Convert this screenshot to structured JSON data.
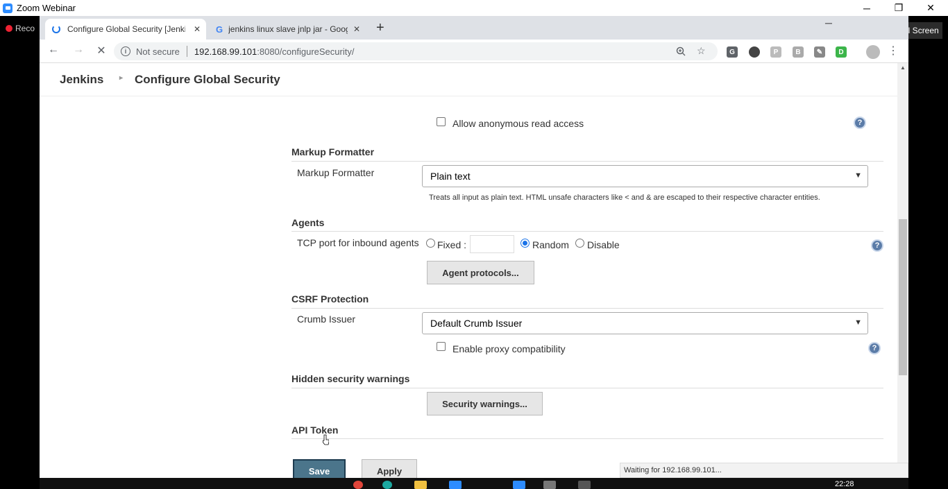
{
  "zoom": {
    "title": "Zoom Webinar",
    "recording_label": "Reco",
    "fullscreen_label": "Enter Full Screen",
    "minimize": "─",
    "restore": "❐",
    "close": "✕"
  },
  "browser": {
    "tabs": [
      {
        "title": "Configure Global Security [Jenkins]",
        "close": "✕"
      },
      {
        "title": "jenkins linux slave jnlp jar - Goog",
        "close": "✕"
      }
    ],
    "new_tab": "+",
    "not_secure": "Not secure",
    "url_host": "192.168.99.101",
    "url_rest": ":8080/configureSecurity/",
    "status_text": "Waiting for 192.168.99.101..."
  },
  "jenkins": {
    "breadcrumb_root": "Jenkins",
    "breadcrumb_page": "Configure Global Security",
    "allow_anonymous_label": "Allow anonymous read access",
    "markup_formatter": {
      "section": "Markup Formatter",
      "label": "Markup Formatter",
      "selected": "Plain text",
      "description": "Treats all input as plain text. HTML unsafe characters like < and & are escaped to their respective character entities."
    },
    "agents": {
      "section": "Agents",
      "label": "TCP port for inbound agents",
      "fixed": "Fixed :",
      "fixed_value": "",
      "random": "Random",
      "disable": "Disable",
      "protocols_button": "Agent protocols..."
    },
    "csrf": {
      "section": "CSRF Protection",
      "label": "Crumb Issuer",
      "selected": "Default Crumb Issuer",
      "proxy_label": "Enable proxy compatibility"
    },
    "hidden_warnings": {
      "section": "Hidden security warnings",
      "button": "Security warnings..."
    },
    "api_token": {
      "section": "API Token"
    },
    "save": "Save",
    "apply": "Apply",
    "help": "?"
  },
  "taskbar": {
    "time": "22:28"
  }
}
